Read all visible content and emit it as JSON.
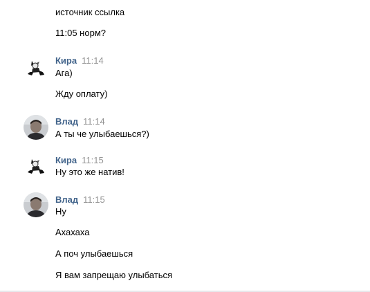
{
  "messages": {
    "top_lines": [
      "источник ссылка",
      "11:05 норм?"
    ],
    "groups": [
      {
        "author": "Кира",
        "time": "11:14",
        "avatar_icon": "kira-avatar-icon",
        "lines": [
          "Ага)",
          "Жду оплату)"
        ]
      },
      {
        "author": "Влад",
        "time": "11:14",
        "avatar_icon": "vlad-avatar-icon",
        "lines": [
          "А ты че улыбаешься?)"
        ]
      },
      {
        "author": "Кира",
        "time": "11:15",
        "avatar_icon": "kira-avatar-icon",
        "lines": [
          "Ну это же натив!"
        ]
      },
      {
        "author": "Влад",
        "time": "11:15",
        "avatar_icon": "vlad-avatar-icon",
        "lines": [
          "Ну",
          "Ахахаха",
          "А поч улыбаешься",
          "Я вам запрещаю улыбаться"
        ]
      }
    ]
  },
  "colors": {
    "author": "#42648b",
    "time": "#939393",
    "text": "#000000",
    "background": "#ffffff"
  }
}
